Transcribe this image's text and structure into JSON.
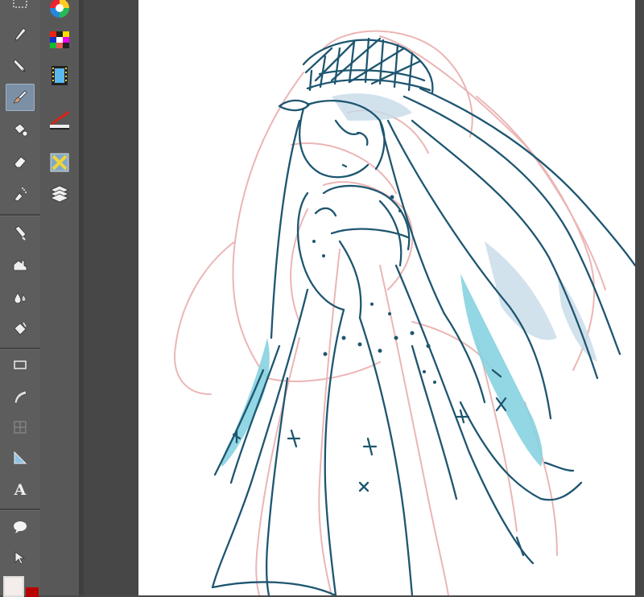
{
  "app": {
    "type": "drawing-application"
  },
  "tools": [
    {
      "name": "marquee-tool",
      "icon": "marquee-icon"
    },
    {
      "name": "pen-tool",
      "icon": "pen-icon"
    },
    {
      "name": "pencil-tool",
      "icon": "pencil-icon"
    },
    {
      "name": "brush-tool",
      "icon": "brush-icon",
      "active": true
    },
    {
      "name": "fill-tool",
      "icon": "paint-bucket-icon"
    },
    {
      "name": "eraser-tool",
      "icon": "eraser-icon"
    },
    {
      "name": "airbrush-tool",
      "icon": "airbrush-icon"
    },
    {
      "name": "blend-tool",
      "icon": "blend-icon"
    },
    {
      "name": "decoration-tool",
      "icon": "decoration-icon"
    },
    {
      "name": "blur-tool",
      "icon": "droplet-icon"
    },
    {
      "name": "color-fill-tool",
      "icon": "bucket-icon"
    },
    {
      "name": "rectangle-tool",
      "icon": "rectangle-icon"
    },
    {
      "name": "curve-tool",
      "icon": "curve-icon"
    },
    {
      "name": "frame-tool",
      "icon": "frame-icon"
    },
    {
      "name": "ruler-tool",
      "icon": "ruler-icon"
    },
    {
      "name": "text-tool",
      "icon": "text-icon",
      "label": "A"
    },
    {
      "name": "balloon-tool",
      "icon": "speech-balloon-icon"
    },
    {
      "name": "object-tool",
      "icon": "object-select-icon"
    }
  ],
  "panel_tools": [
    {
      "name": "color-wheel",
      "icon": "color-wheel-icon"
    },
    {
      "name": "color-set",
      "icon": "color-palette-icon"
    },
    {
      "name": "animation",
      "icon": "film-strip-icon"
    },
    {
      "name": "tool-property",
      "icon": "brush-stroke-icon"
    },
    {
      "name": "navigator",
      "icon": "navigator-icon"
    },
    {
      "name": "layers",
      "icon": "layers-icon"
    }
  ],
  "colors": {
    "main_color": "#f5ecec",
    "sub_color": "#b80000",
    "sketch_line": "#1e5670",
    "rough_line": "#e8a9a9",
    "fill_cyan": "#86d3e0",
    "fill_blue": "#c7dbe8"
  }
}
